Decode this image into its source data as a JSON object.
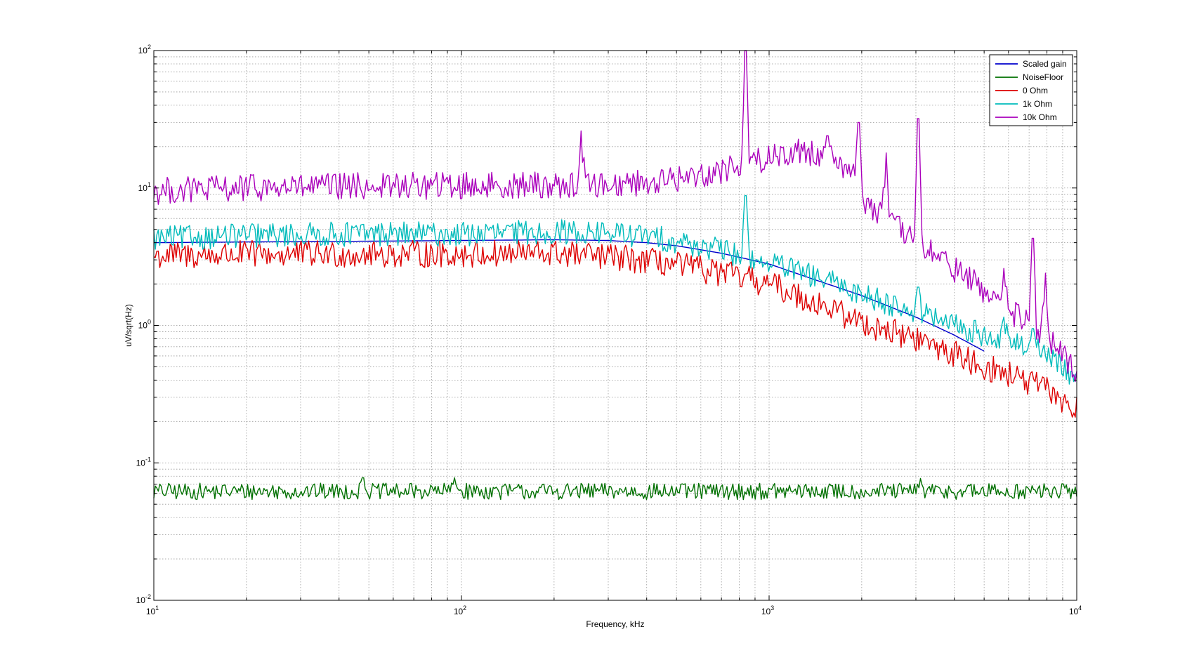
{
  "chart_data": {
    "type": "line",
    "xlabel": "Frequency, kHz",
    "ylabel": "uV/sqrt(Hz)",
    "xscale": "log",
    "yscale": "log",
    "xlim": [
      10,
      10000
    ],
    "ylim": [
      0.01,
      100
    ],
    "grid": true,
    "legend_position": "top-right",
    "x_ticks": [
      {
        "base": "10",
        "exp": "1"
      },
      {
        "base": "10",
        "exp": "2"
      },
      {
        "base": "10",
        "exp": "3"
      },
      {
        "base": "10",
        "exp": "4"
      }
    ],
    "y_ticks": [
      {
        "base": "10",
        "exp": "-2"
      },
      {
        "base": "10",
        "exp": "-1"
      },
      {
        "base": "10",
        "exp": "0"
      },
      {
        "base": "10",
        "exp": "1"
      },
      {
        "base": "10",
        "exp": "2"
      }
    ],
    "series": [
      {
        "name": "Scaled gain",
        "color": "#0000cc",
        "style": "smooth",
        "x": [
          10,
          20,
          50,
          100,
          200,
          300,
          400,
          500,
          700,
          1000,
          1500,
          2000,
          3000,
          4000,
          5000
        ],
        "y": [
          4.0,
          4.05,
          4.1,
          4.15,
          4.2,
          4.15,
          4.0,
          3.8,
          3.35,
          2.8,
          2.05,
          1.65,
          1.15,
          0.85,
          0.65
        ]
      },
      {
        "name": "NoiseFloor",
        "color": "#007000",
        "style": "noisy",
        "noise": 0.06,
        "x": [
          10,
          100,
          1000,
          10000
        ],
        "y": [
          0.062,
          0.062,
          0.062,
          0.062
        ],
        "spikes": [
          {
            "x": 25,
            "y": 0.048
          },
          {
            "x": 48,
            "y": 0.078
          },
          {
            "x": 95,
            "y": 0.078
          },
          {
            "x": 390,
            "y": 0.046
          },
          {
            "x": 1750,
            "y": 0.042
          },
          {
            "x": 3100,
            "y": 0.077
          }
        ]
      },
      {
        "name": "0 Ohm",
        "color": "#dd0000",
        "style": "noisy",
        "noise": 0.1,
        "x": [
          10,
          20,
          50,
          100,
          200,
          300,
          400,
          500,
          700,
          1000,
          1500,
          2000,
          3000,
          4000,
          5000,
          6000,
          8000,
          10000
        ],
        "y": [
          3.2,
          3.3,
          3.3,
          3.3,
          3.35,
          3.15,
          2.95,
          2.75,
          2.4,
          2.0,
          1.4,
          1.05,
          0.8,
          0.62,
          0.5,
          0.44,
          0.34,
          0.24
        ],
        "spikes": []
      },
      {
        "name": "1k Ohm",
        "color": "#00bbbb",
        "style": "noisy",
        "noise": 0.09,
        "x": [
          10,
          20,
          50,
          100,
          200,
          300,
          400,
          500,
          700,
          1000,
          1500,
          2000,
          3000,
          4000,
          5000,
          6000,
          7000,
          8000,
          9000,
          10000
        ],
        "y": [
          4.3,
          4.5,
          4.65,
          4.6,
          4.8,
          4.7,
          4.45,
          4.1,
          3.5,
          2.85,
          2.15,
          1.7,
          1.25,
          1.0,
          0.85,
          0.75,
          0.7,
          0.62,
          0.5,
          0.4
        ],
        "spikes": [
          {
            "x": 840,
            "y": 8.8
          },
          {
            "x": 3050,
            "y": 1.9
          },
          {
            "x": 5800,
            "y": 1.15
          },
          {
            "x": 7200,
            "y": 0.95
          }
        ]
      },
      {
        "name": "10k Ohm",
        "color": "#aa00bb",
        "style": "noisy",
        "noise": 0.1,
        "x": [
          10,
          20,
          50,
          100,
          200,
          300,
          500,
          700,
          900,
          1000,
          1300,
          1600,
          1900,
          2000,
          2500,
          3000,
          3500,
          4000,
          5000,
          6000,
          7000,
          8000,
          9000,
          10000
        ],
        "y": [
          9.5,
          10.0,
          10.3,
          10.4,
          10.5,
          10.6,
          11.5,
          13.5,
          15.5,
          17.0,
          18.5,
          17.5,
          12.0,
          8.5,
          5.5,
          4.0,
          3.2,
          2.6,
          1.8,
          1.3,
          1.0,
          0.8,
          0.6,
          0.45
        ],
        "spikes": [
          {
            "x": 245,
            "y": 26
          },
          {
            "x": 840,
            "y": 100
          },
          {
            "x": 1550,
            "y": 24
          },
          {
            "x": 1950,
            "y": 30
          },
          {
            "x": 2400,
            "y": 18
          },
          {
            "x": 3050,
            "y": 32
          },
          {
            "x": 5800,
            "y": 2.6
          },
          {
            "x": 7200,
            "y": 4.3
          },
          {
            "x": 7900,
            "y": 2.4
          }
        ]
      }
    ]
  }
}
